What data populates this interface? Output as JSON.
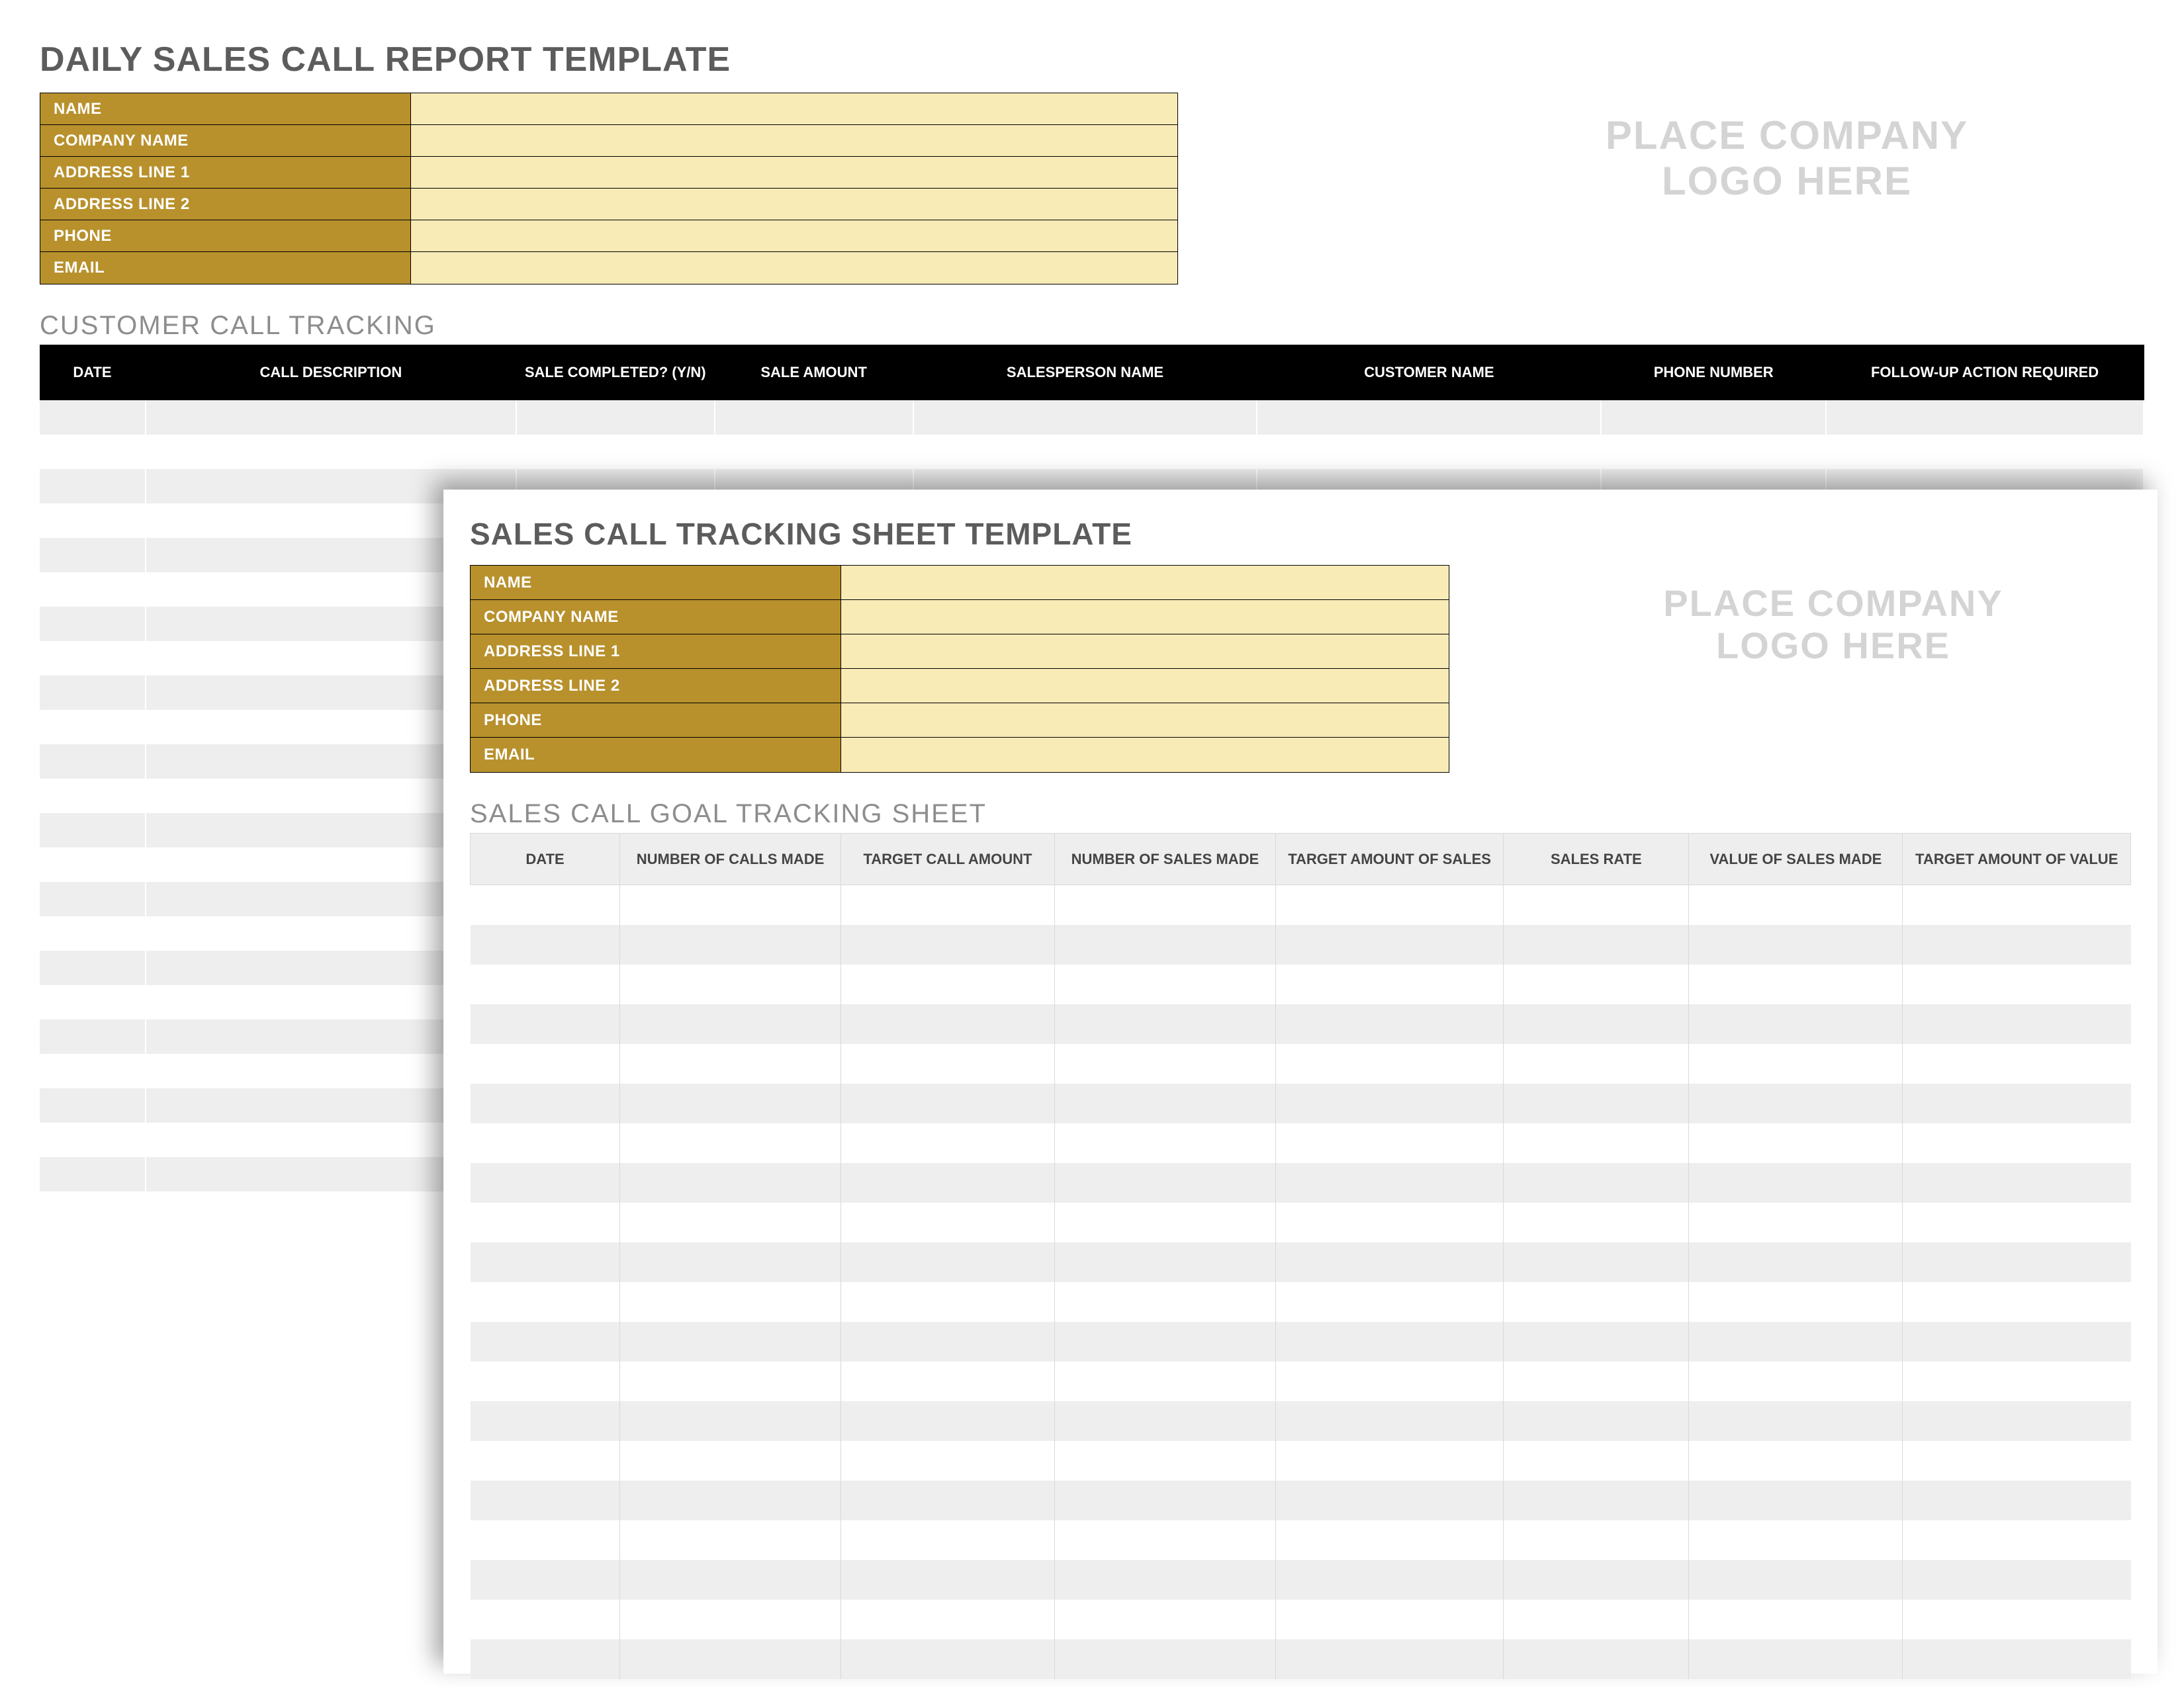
{
  "back": {
    "title": "DAILY SALES CALL REPORT TEMPLATE",
    "info_labels": [
      "NAME",
      "COMPANY NAME",
      "ADDRESS LINE 1",
      "ADDRESS LINE 2",
      "PHONE",
      "EMAIL"
    ],
    "logo_line1": "PLACE COMPANY",
    "logo_line2": "LOGO HERE",
    "section": "CUSTOMER CALL TRACKING",
    "columns": [
      "DATE",
      "CALL DESCRIPTION",
      "SALE COMPLETED? (Y/N)",
      "SALE AMOUNT",
      "SALESPERSON NAME",
      "CUSTOMER NAME",
      "PHONE NUMBER",
      "FOLLOW-UP ACTION REQUIRED"
    ],
    "blank_rows": 24
  },
  "front": {
    "title": "SALES CALL TRACKING SHEET TEMPLATE",
    "info_labels": [
      "NAME",
      "COMPANY NAME",
      "ADDRESS LINE 1",
      "ADDRESS LINE 2",
      "PHONE",
      "EMAIL"
    ],
    "logo_line1": "PLACE COMPANY",
    "logo_line2": "LOGO HERE",
    "section": "SALES CALL GOAL TRACKING SHEET",
    "columns": [
      "DATE",
      "NUMBER OF CALLS MADE",
      "TARGET CALL AMOUNT",
      "NUMBER OF SALES MADE",
      "TARGET AMOUNT OF SALES",
      "SALES RATE",
      "VALUE OF SALES MADE",
      "TARGET AMOUNT OF VALUE"
    ],
    "blank_rows": 20
  }
}
